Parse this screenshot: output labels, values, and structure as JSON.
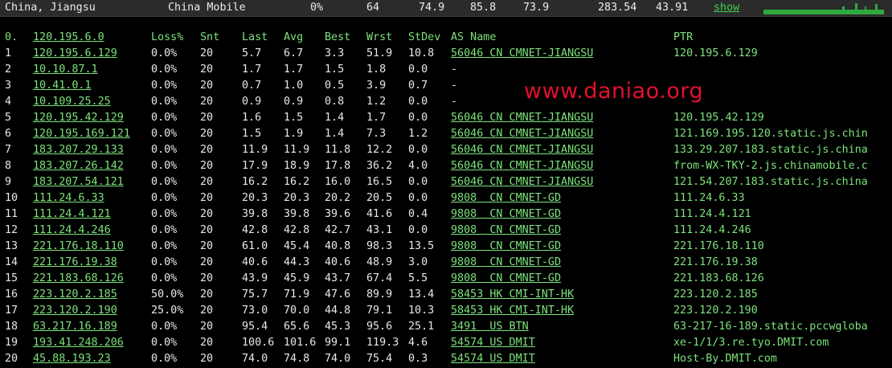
{
  "summary": {
    "location": "China, Jiangsu",
    "provider": "China Mobile",
    "loss": "0%",
    "snt": "64",
    "last": "74.9",
    "avg": "85.8",
    "best": "73.9",
    "wrst": "283.54",
    "stdev": "43.91",
    "show_label": "show"
  },
  "colors": {
    "accent": "#7be37b",
    "watermark": "#e3102c",
    "background": "#000000"
  },
  "watermark": "www.daniao.org",
  "header": {
    "hop": "0.",
    "ip": "120.195.6.0",
    "loss": "Loss%",
    "snt": "Snt",
    "last": "Last",
    "avg": "Avg",
    "best": "Best",
    "wrst": "Wrst",
    "stdev": "StDev",
    "as": "AS Name",
    "ptr": "PTR"
  },
  "hops": [
    {
      "hop": "1",
      "ip": "120.195.6.129",
      "loss": "0.0%",
      "snt": "20",
      "last": "5.7",
      "avg": "6.7",
      "best": "3.3",
      "wrst": "51.9",
      "stdev": "10.8",
      "as": "56046 CN CMNET-JIANGSU",
      "ptr": "120.195.6.129"
    },
    {
      "hop": "2",
      "ip": "10.10.87.1",
      "loss": "0.0%",
      "snt": "20",
      "last": "1.7",
      "avg": "1.7",
      "best": "1.5",
      "wrst": "1.8",
      "stdev": "0.0",
      "as": "-",
      "ptr": ""
    },
    {
      "hop": "3",
      "ip": "10.41.0.1",
      "loss": "0.0%",
      "snt": "20",
      "last": "0.7",
      "avg": "1.0",
      "best": "0.5",
      "wrst": "3.9",
      "stdev": "0.7",
      "as": "-",
      "ptr": ""
    },
    {
      "hop": "4",
      "ip": "10.109.25.25",
      "loss": "0.0%",
      "snt": "20",
      "last": "0.9",
      "avg": "0.9",
      "best": "0.8",
      "wrst": "1.2",
      "stdev": "0.0",
      "as": "-",
      "ptr": ""
    },
    {
      "hop": "5",
      "ip": "120.195.42.129",
      "loss": "0.0%",
      "snt": "20",
      "last": "1.6",
      "avg": "1.5",
      "best": "1.4",
      "wrst": "1.7",
      "stdev": "0.0",
      "as": "56046 CN CMNET-JIANGSU",
      "ptr": "120.195.42.129"
    },
    {
      "hop": "6",
      "ip": "120.195.169.121",
      "loss": "0.0%",
      "snt": "20",
      "last": "1.5",
      "avg": "1.9",
      "best": "1.4",
      "wrst": "7.3",
      "stdev": "1.2",
      "as": "56046 CN CMNET-JIANGSU",
      "ptr": "121.169.195.120.static.js.chin"
    },
    {
      "hop": "7",
      "ip": "183.207.29.133",
      "loss": "0.0%",
      "snt": "20",
      "last": "11.9",
      "avg": "11.9",
      "best": "11.8",
      "wrst": "12.2",
      "stdev": "0.0",
      "as": "56046 CN CMNET-JIANGSU",
      "ptr": "133.29.207.183.static.js.china"
    },
    {
      "hop": "8",
      "ip": "183.207.26.142",
      "loss": "0.0%",
      "snt": "20",
      "last": "17.9",
      "avg": "18.9",
      "best": "17.8",
      "wrst": "36.2",
      "stdev": "4.0",
      "as": "56046 CN CMNET-JIANGSU",
      "ptr": "from-WX-TKY-2.js.chinamobile.c"
    },
    {
      "hop": "9",
      "ip": "183.207.54.121",
      "loss": "0.0%",
      "snt": "20",
      "last": "16.2",
      "avg": "16.2",
      "best": "16.0",
      "wrst": "16.5",
      "stdev": "0.0",
      "as": "56046 CN CMNET-JIANGSU",
      "ptr": "121.54.207.183.static.js.china"
    },
    {
      "hop": "10",
      "ip": "111.24.6.33",
      "loss": "0.0%",
      "snt": "20",
      "last": "20.3",
      "avg": "20.3",
      "best": "20.2",
      "wrst": "20.5",
      "stdev": "0.0",
      "as": "9808  CN CMNET-GD",
      "ptr": "111.24.6.33"
    },
    {
      "hop": "11",
      "ip": "111.24.4.121",
      "loss": "0.0%",
      "snt": "20",
      "last": "39.8",
      "avg": "39.8",
      "best": "39.6",
      "wrst": "41.6",
      "stdev": "0.4",
      "as": "9808  CN CMNET-GD",
      "ptr": "111.24.4.121"
    },
    {
      "hop": "12",
      "ip": "111.24.4.246",
      "loss": "0.0%",
      "snt": "20",
      "last": "42.8",
      "avg": "42.8",
      "best": "42.7",
      "wrst": "43.1",
      "stdev": "0.0",
      "as": "9808  CN CMNET-GD",
      "ptr": "111.24.4.246"
    },
    {
      "hop": "13",
      "ip": "221.176.18.110",
      "loss": "0.0%",
      "snt": "20",
      "last": "61.0",
      "avg": "45.4",
      "best": "40.8",
      "wrst": "98.3",
      "stdev": "13.5",
      "as": "9808  CN CMNET-GD",
      "ptr": "221.176.18.110"
    },
    {
      "hop": "14",
      "ip": "221.176.19.38",
      "loss": "0.0%",
      "snt": "20",
      "last": "40.6",
      "avg": "44.3",
      "best": "40.6",
      "wrst": "48.9",
      "stdev": "3.0",
      "as": "9808  CN CMNET-GD",
      "ptr": "221.176.19.38"
    },
    {
      "hop": "15",
      "ip": "221.183.68.126",
      "loss": "0.0%",
      "snt": "20",
      "last": "43.9",
      "avg": "45.9",
      "best": "43.7",
      "wrst": "67.4",
      "stdev": "5.5",
      "as": "9808  CN CMNET-GD",
      "ptr": "221.183.68.126"
    },
    {
      "hop": "16",
      "ip": "223.120.2.185",
      "loss": "50.0%",
      "snt": "20",
      "last": "75.7",
      "avg": "71.9",
      "best": "47.6",
      "wrst": "89.9",
      "stdev": "13.4",
      "as": "58453 HK CMI-INT-HK",
      "ptr": "223.120.2.185"
    },
    {
      "hop": "17",
      "ip": "223.120.2.190",
      "loss": "25.0%",
      "snt": "20",
      "last": "73.0",
      "avg": "70.0",
      "best": "44.8",
      "wrst": "79.1",
      "stdev": "10.3",
      "as": "58453 HK CMI-INT-HK",
      "ptr": "223.120.2.190"
    },
    {
      "hop": "18",
      "ip": "63.217.16.189",
      "loss": "0.0%",
      "snt": "20",
      "last": "95.4",
      "avg": "65.6",
      "best": "45.3",
      "wrst": "95.6",
      "stdev": "25.1",
      "as": "3491  US BTN",
      "ptr": "63-217-16-189.static.pccwgloba"
    },
    {
      "hop": "19",
      "ip": "193.41.248.206",
      "loss": "0.0%",
      "snt": "20",
      "last": "100.6",
      "avg": "101.6",
      "best": "99.1",
      "wrst": "119.3",
      "stdev": "4.6",
      "as": "54574 US DMIT",
      "ptr": "xe-1/1/3.re.tyo.DMIT.com"
    },
    {
      "hop": "20",
      "ip": "45.88.193.23",
      "loss": "0.0%",
      "snt": "20",
      "last": "74.0",
      "avg": "74.8",
      "best": "74.0",
      "wrst": "75.4",
      "stdev": "0.3",
      "as": "54574 US DMIT",
      "ptr": "Host-By.DMIT.com"
    }
  ]
}
